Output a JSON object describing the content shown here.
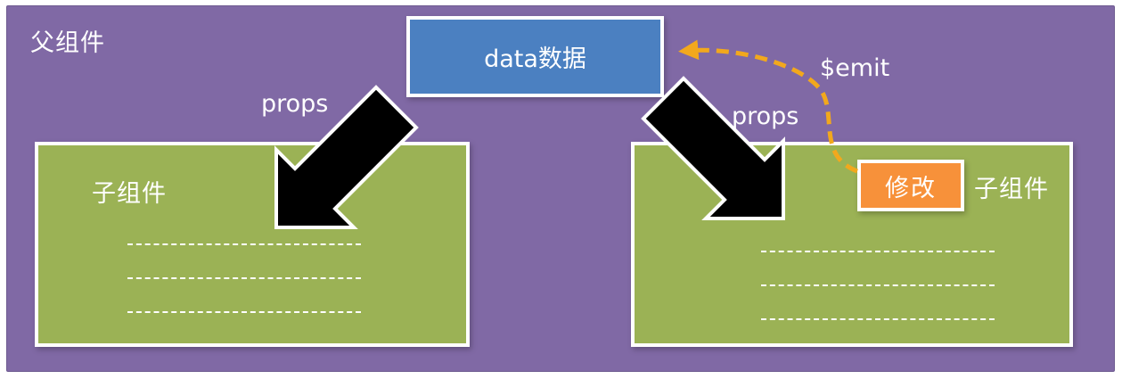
{
  "parent": {
    "label": "父组件",
    "color": "#8069a5"
  },
  "data_node": {
    "label": "data数据",
    "color": "#4b80c1"
  },
  "left_child": {
    "label": "子组件",
    "color": "#9bb255",
    "placeholder_lines": 3
  },
  "right_child": {
    "label": "子组件",
    "color": "#9bb255",
    "placeholder_lines": 3,
    "modify_button": {
      "label": "修改",
      "color": "#f7913a"
    }
  },
  "edges": {
    "props_left": "props",
    "props_right": "props",
    "emit": "$emit",
    "emit_color": "#f2a81d"
  }
}
